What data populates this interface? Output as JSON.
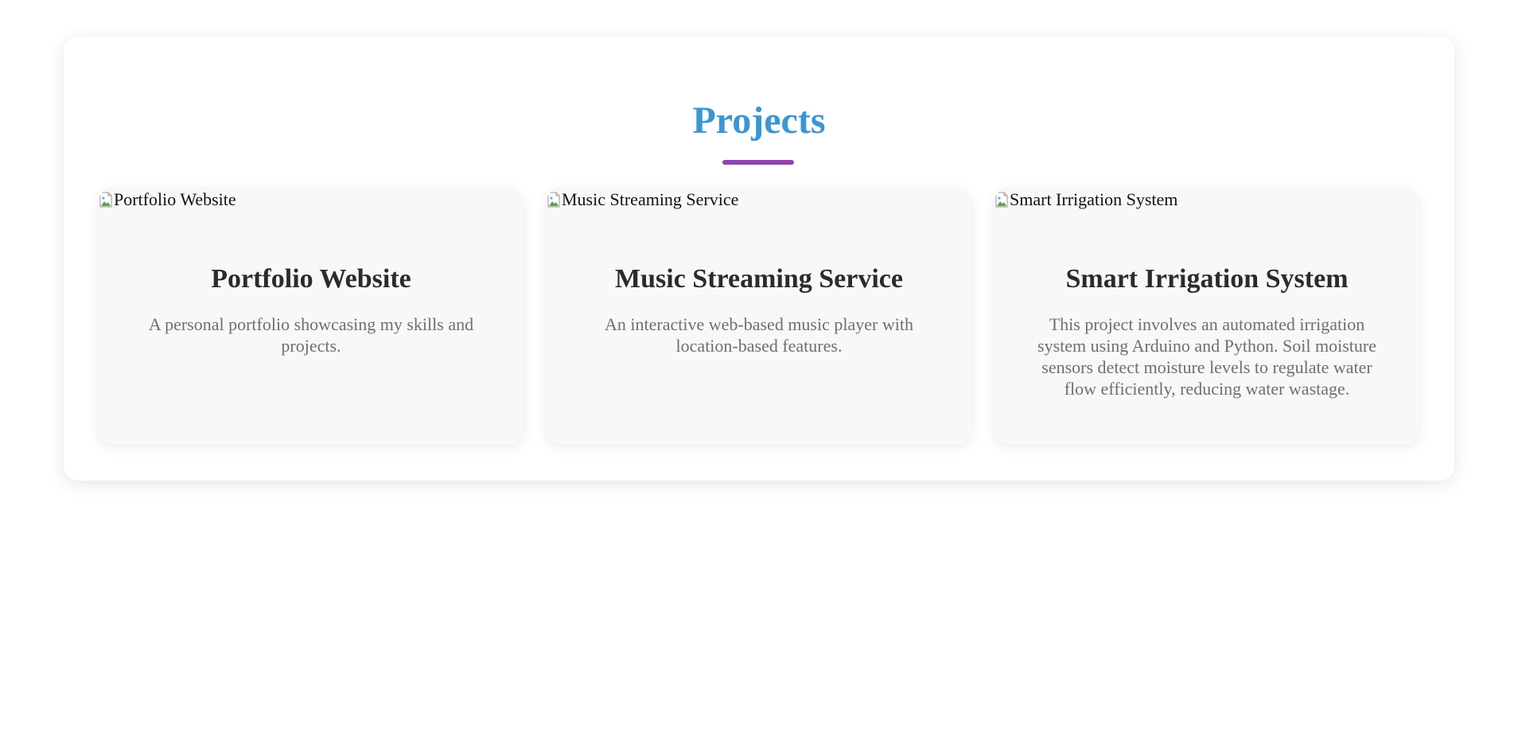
{
  "section": {
    "title": "Projects",
    "title_color": "#3a96d4",
    "underline_color": "#8e44ad"
  },
  "projects": [
    {
      "image_alt": "Portfolio Website",
      "title": "Portfolio Website",
      "description": "A personal portfolio showcasing my skills and projects."
    },
    {
      "image_alt": "Music Streaming Service",
      "title": "Music Streaming Service",
      "description": "An interactive web-based music player with location-based features."
    },
    {
      "image_alt": "Smart Irrigation System",
      "title": "Smart Irrigation System",
      "description": "This project involves an automated irrigation system using Arduino and Python. Soil moisture sensors detect moisture levels to regulate water flow efficiently, reducing water wastage."
    }
  ],
  "icons": {
    "broken_image": "broken-image-icon"
  }
}
